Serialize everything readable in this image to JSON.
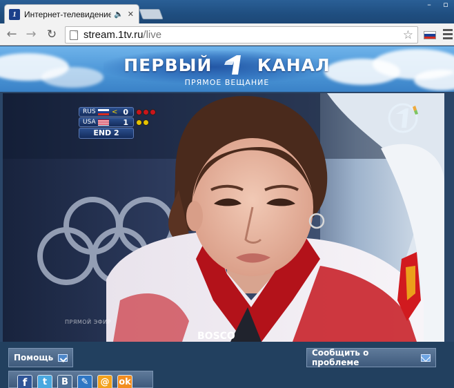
{
  "browser": {
    "tab_title": "Интернет-телевидение",
    "tab_favicon": "1",
    "url_host": "stream.1tv.ru",
    "url_path": "/live",
    "icons": [
      "back-arrow-icon",
      "forward-arrow-icon",
      "reload-icon",
      "page-icon",
      "star-icon",
      "russian-flag-icon",
      "menu-icon",
      "speaker-icon",
      "close-icon"
    ]
  },
  "banner": {
    "title_left": "ПЕРВЫЙ",
    "title_right": "КАНАЛ",
    "subtitle": "ПРЯМОЕ ВЕЩАНИЕ"
  },
  "video": {
    "scoreboard": {
      "rows": [
        {
          "team": "RUS",
          "score": "0",
          "hammer": "<",
          "stone_color": "#c9151b"
        },
        {
          "team": "USA",
          "score": "1",
          "hammer": "",
          "stone_color": "#e6c300"
        }
      ],
      "end": "END 2"
    },
    "channel_bug": "1",
    "live_caption": "ПРЯМОЙ ЭФИР",
    "sponsor": "BOSCO"
  },
  "controls": {
    "help_label": "Помощь",
    "report_label": "Сообщить о проблеме",
    "share": [
      {
        "id": "facebook",
        "glyph": "f"
      },
      {
        "id": "twitter",
        "glyph": "t"
      },
      {
        "id": "vkontakte",
        "glyph": "B"
      },
      {
        "id": "livejournal",
        "glyph": "✎"
      },
      {
        "id": "mailru",
        "glyph": "@"
      },
      {
        "id": "odnoklassniki",
        "glyph": "ok"
      }
    ]
  },
  "colors": {
    "page_bg": "#1f3a5c",
    "button_bg": "#4f6a8b",
    "banner_sky": "#4d97d8"
  }
}
